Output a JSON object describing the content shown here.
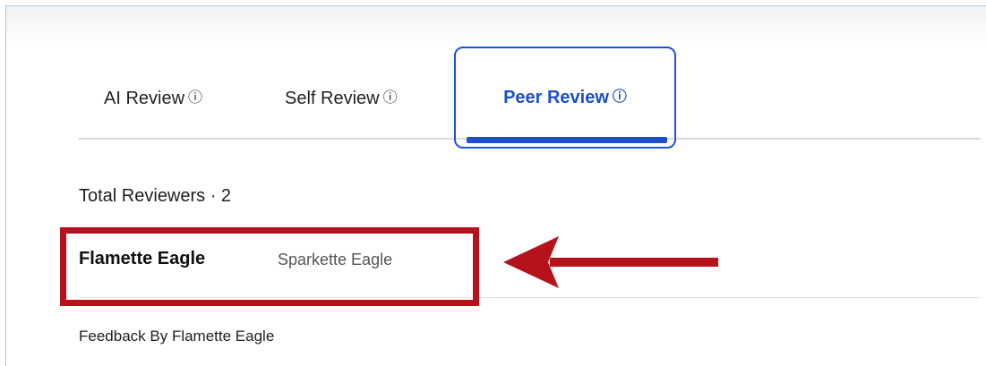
{
  "tabs": [
    {
      "label": "AI Review",
      "info_icon": "info-circle-icon",
      "active": false
    },
    {
      "label": "Self Review",
      "info_icon": "info-circle-icon",
      "active": false
    },
    {
      "label": "Peer Review",
      "info_icon": "info-circle-icon",
      "active": true
    }
  ],
  "info_glyph": "ⓘ",
  "reviewers": {
    "total_label": "Total Reviewers · 2",
    "items": [
      {
        "name": "Flamette Eagle",
        "active": true
      },
      {
        "name": "Sparkette Eagle",
        "active": false
      }
    ]
  },
  "feedback": {
    "heading": "Feedback By Flamette Eagle"
  },
  "annotation": {
    "color": "#b5121b",
    "shapes": [
      "highlight-rectangle",
      "arrow-left"
    ]
  },
  "colors": {
    "accent": "#1d4fc6",
    "annotation": "#b5121b"
  }
}
